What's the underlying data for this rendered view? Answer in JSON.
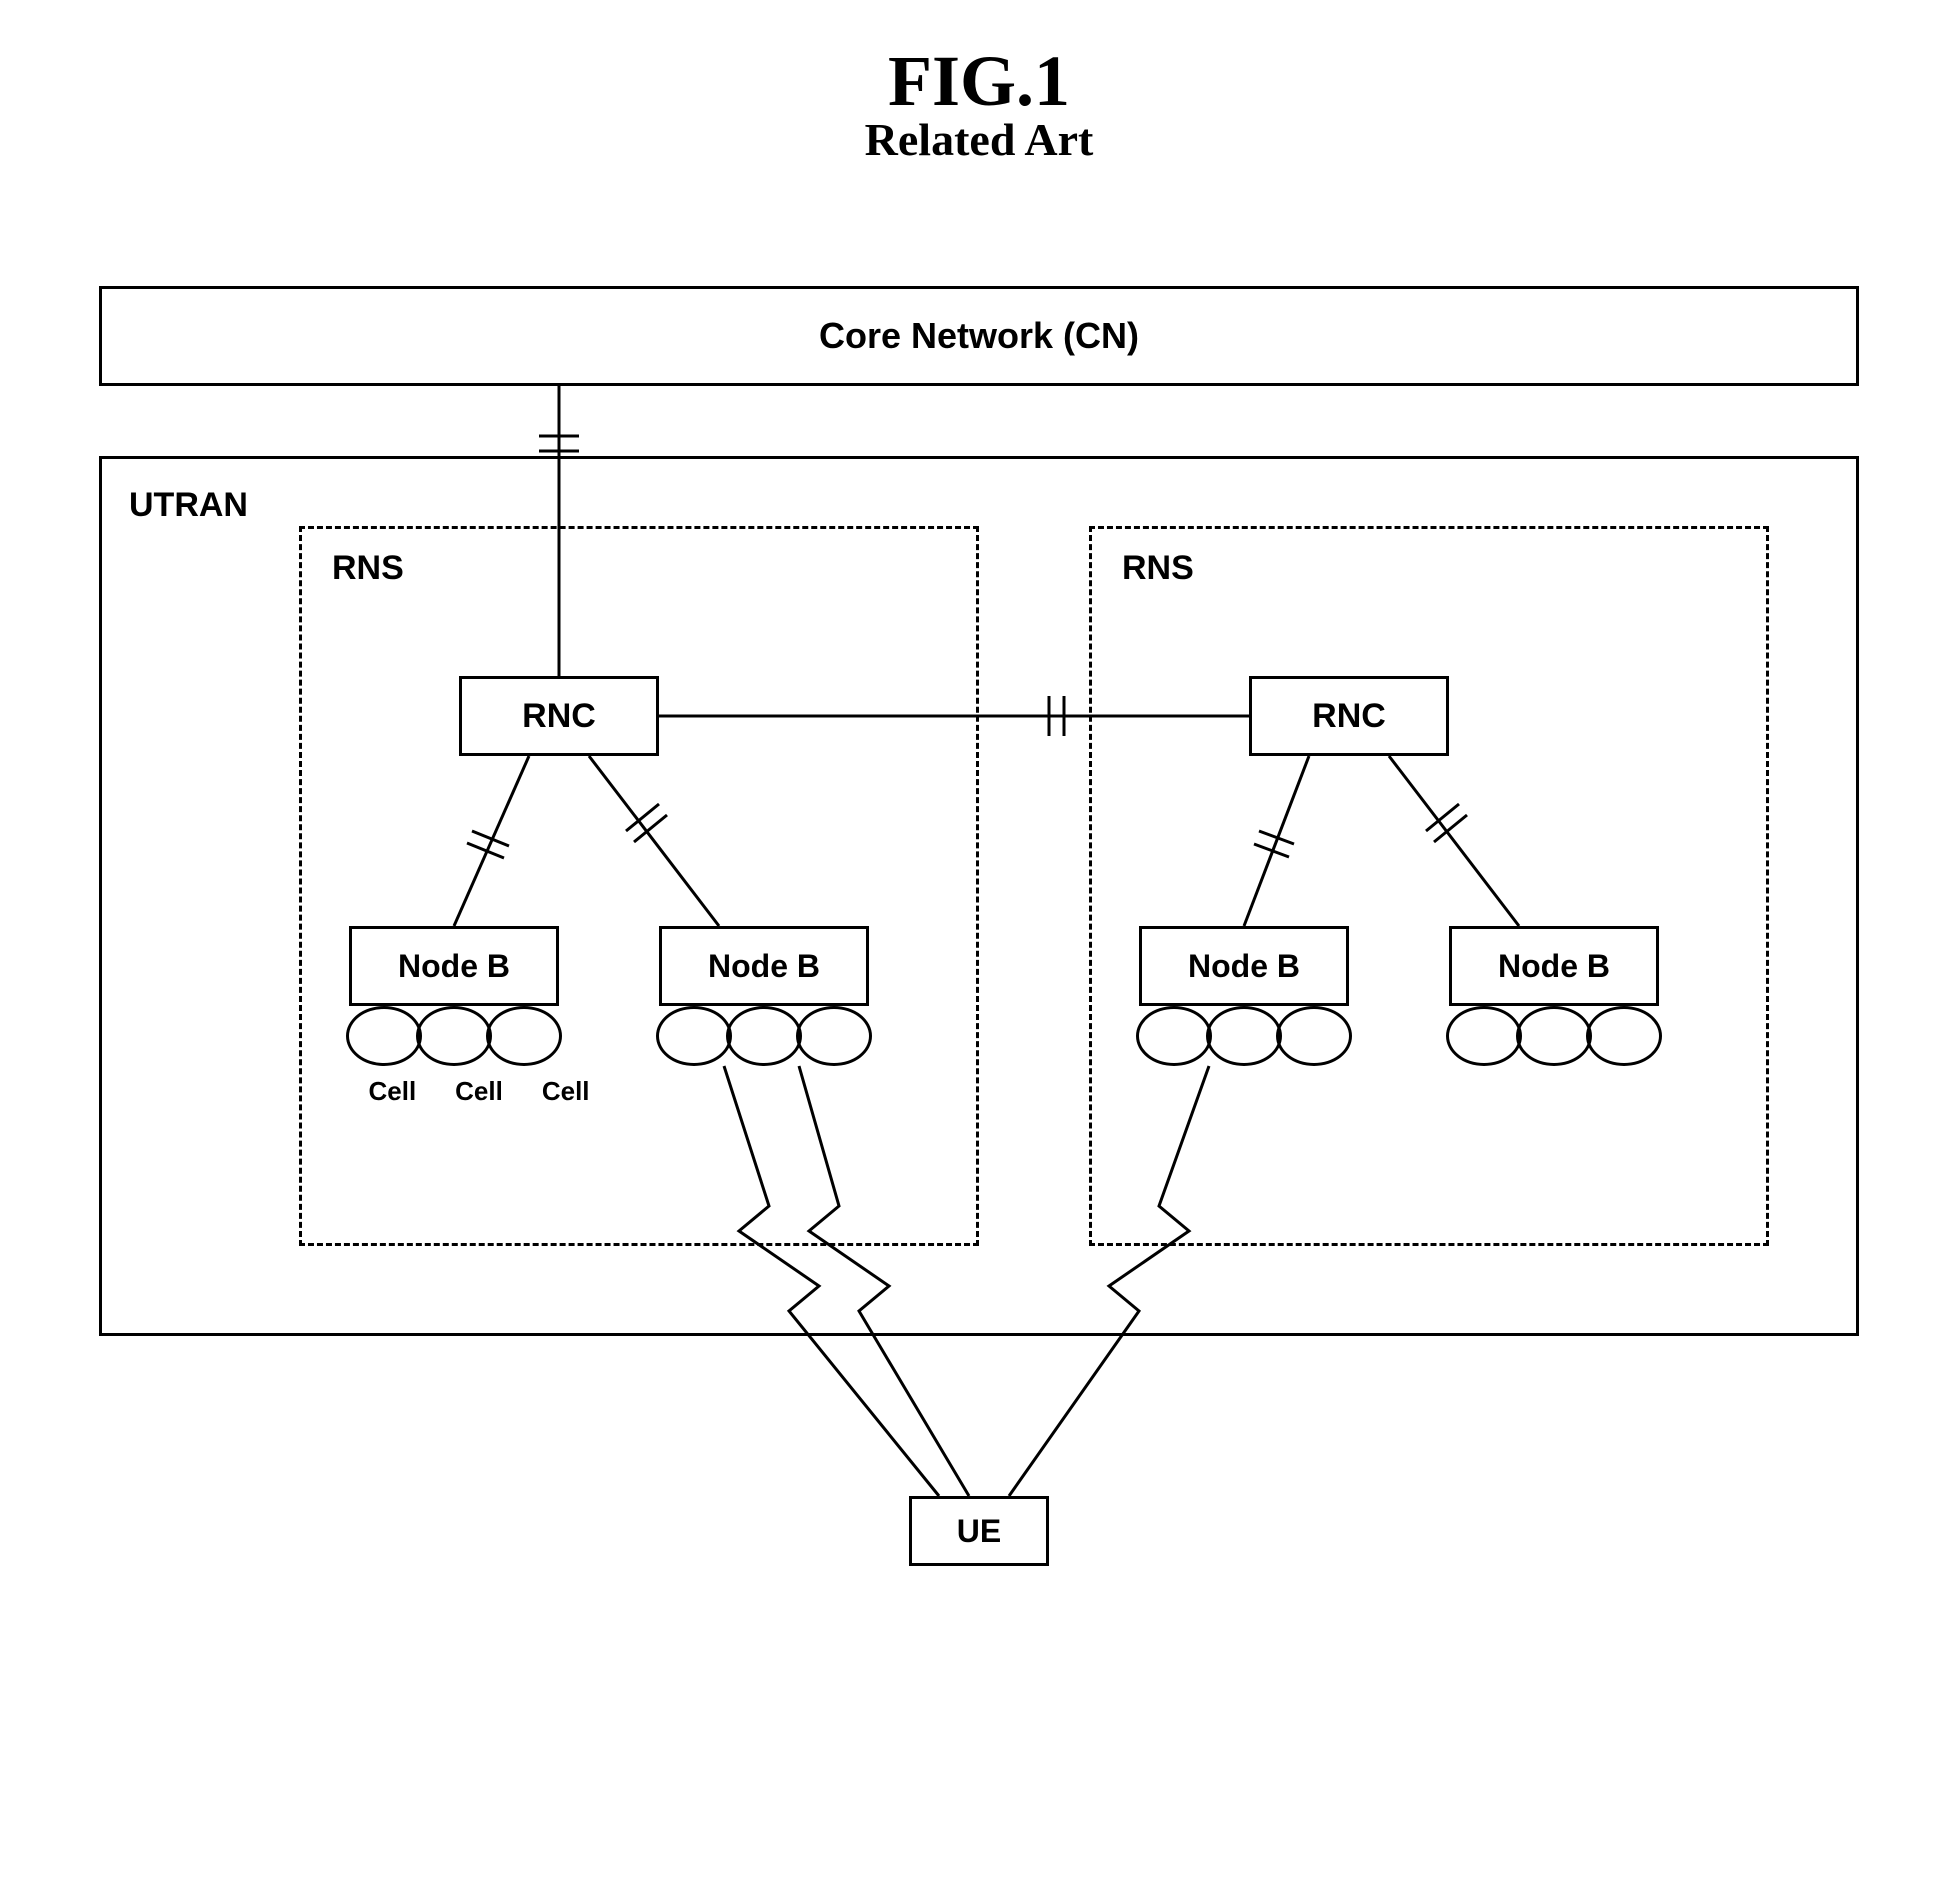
{
  "figure": {
    "number": "FIG.1",
    "subtitle": "Related Art"
  },
  "diagram": {
    "core_network": "Core Network (CN)",
    "utran_label": "UTRAN",
    "rns_label_1": "RNS",
    "rns_label_2": "RNS",
    "rnc_label_1": "RNC",
    "rnc_label_2": "RNC",
    "nodeb_label_1": "Node B",
    "nodeb_label_2": "Node B",
    "nodeb_label_3": "Node B",
    "nodeb_label_4": "Node B",
    "cell_label_1": "Cell",
    "cell_label_2": "Cell",
    "cell_label_3": "Cell",
    "ue_label": "UE"
  }
}
